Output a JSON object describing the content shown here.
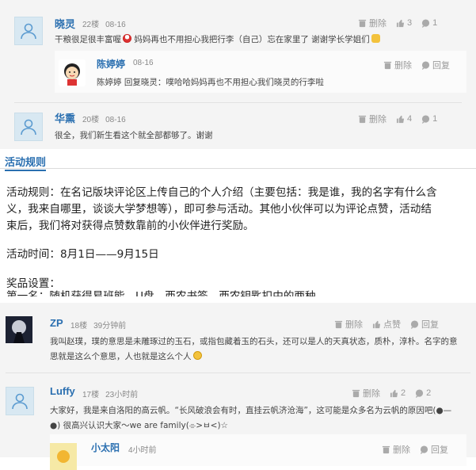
{
  "comments_top": [
    {
      "user": "晓灵",
      "floor": "22楼",
      "time": "08-16",
      "text": "干粮很足很丰富喔",
      "text_b": "妈妈再也不用担心我把行李（自己）忘在家里了 谢谢学长学姐们",
      "delete": "删除",
      "likes": "3",
      "replies": "1"
    },
    {
      "user": "陈婷婷",
      "time": "08-16",
      "text": "陈婷婷 回复晓灵：噗哈哈妈妈再也不用担心我们晓灵的行李啦",
      "delete": "删除",
      "reply": "回复"
    },
    {
      "user": "华熏",
      "floor": "20楼",
      "time": "08-16",
      "text": "很全，我们新生看这个就全部都够了。谢谢",
      "delete": "删除",
      "likes": "4",
      "replies": "1"
    }
  ],
  "rules": {
    "heading": "活动规则",
    "line1": "活动规则：在名记版块评论区上传自己的个人介绍（主要包括：我是谁，我的名字有什么含",
    "line2": "义，我来自哪里，谈谈大学梦想等），即可参与活动。其他小伙伴可以为评论点赞，活动结",
    "line3": "束后，我们将对获得点赞数靠前的小伙伴进行奖励。",
    "time": "活动时间：8月1日——9月15日",
    "prize_title": "奖品设置：",
    "prize_line": "第一名：随机获得易班能　U盘　西农书签　西农钥匙扣中的两种"
  },
  "comments_bottom": [
    {
      "user": "ZP",
      "floor": "18楼",
      "time": "39分钟前",
      "text": "我叫赵璞，璞的意思是未雕琢过的玉石，或指包藏着玉的石头，还可以是人的天真状态，质朴，淳朴。名字的意",
      "text2": "思就是这么个意思，人也就是这么个人",
      "delete": "删除",
      "like": "点赞",
      "reply": "回复"
    },
    {
      "user": "Luffy",
      "floor": "17楼",
      "time": "23小时前",
      "text": "大家好，我是来自洛阳的高云帆。“长风破浪会有时，直挂云帆济沧海”，这可能是众多名为云帆的原因吧(●—",
      "text2": "●) 很高兴认识大家～we are family(⌯>ㅂ<)☆",
      "delete": "删除",
      "likes": "2",
      "replies": "2"
    },
    {
      "user": "小太阳",
      "time": "4小时前",
      "delete": "删除",
      "reply": "回复"
    }
  ]
}
